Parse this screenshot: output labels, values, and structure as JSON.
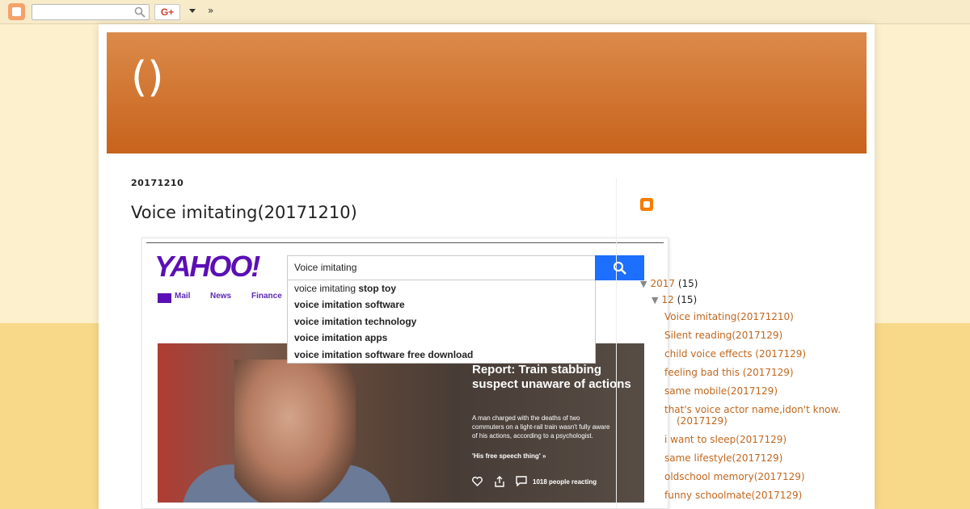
{
  "navbar": {
    "search": {
      "value": "",
      "placeholder": ""
    },
    "gplus_label": "G+",
    "more_label": "»"
  },
  "blog": {
    "title": "()"
  },
  "post": {
    "date": "20171210",
    "title": "Voice imitating(20171210)",
    "image": {
      "logo": "YAHOO!",
      "search_value": "Voice imitating",
      "nav": [
        "Mail",
        "News",
        "Finance"
      ],
      "suggestions": [
        {
          "prefix": "voice imitating ",
          "rest": "stop toy"
        },
        {
          "prefix": "",
          "rest": "voice imitation software"
        },
        {
          "prefix": "",
          "rest": "voice imitation technology"
        },
        {
          "prefix": "",
          "rest": "voice imitation apps"
        },
        {
          "prefix": "",
          "rest": "voice imitation software free download"
        }
      ],
      "headline": "Report: Train stabbing suspect unaware of actions",
      "description": "A man charged with the deaths of two commuters on a light-rail train wasn't fully aware of his actions, according to a psychologist.",
      "quote": "'His free speech thing' »",
      "reactions": "1018 people reacting"
    }
  },
  "sidebar": {
    "archive": {
      "year": {
        "label": "2017",
        "count": "(15)",
        "toggle": "▼"
      },
      "month": {
        "label": "12",
        "count": "(15)",
        "toggle": "▼"
      },
      "posts": [
        "Voice imitating(20171210)",
        "Silent reading(2017129)",
        "child voice effects (2017129)",
        "feeling bad this (2017129)",
        "same mobile(2017129)",
        "that's voice actor name,idon't know.(2017129)",
        "i want to sleep(2017129)",
        "same lifestyle(2017129)",
        "oldschool memory(2017129)",
        "funny schoolmate(2017129)"
      ]
    }
  },
  "colors": {
    "header_top": "#dc8a4a",
    "header_bottom": "#c7631c",
    "link": "#c1671e",
    "background_light": "#fdf0cc",
    "background_dark": "#f8d98a"
  }
}
